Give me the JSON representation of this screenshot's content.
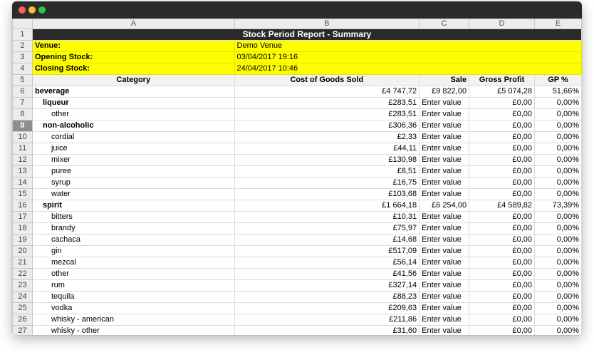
{
  "columns": [
    "A",
    "B",
    "C",
    "D",
    "E"
  ],
  "title": "Stock Period Report - Summary",
  "info": [
    {
      "label": "Venue:",
      "value": "Demo Venue"
    },
    {
      "label": "Opening Stock:",
      "value": "03/04/2017 19:16"
    },
    {
      "label": "Closing Stock:",
      "value": "24/04/2017 10:46"
    }
  ],
  "table_header": {
    "category": "Category",
    "cogs": "Cost of Goods Sold",
    "sale": "Sale",
    "gross_profit": "Gross Profit",
    "gp": "GP %"
  },
  "selected_row": 9,
  "rows": [
    {
      "row": 6,
      "level": 0,
      "category": "beverage",
      "cogs": "£4 747,72",
      "sale": "£9 822,00",
      "profit": "£5 074,28",
      "gp": "51,66%"
    },
    {
      "row": 7,
      "level": 1,
      "category": "liqueur",
      "cogs": "£283,51",
      "sale": "Enter value",
      "profit": "£0,00",
      "gp": "0,00%"
    },
    {
      "row": 8,
      "level": 2,
      "category": "other",
      "cogs": "£283,51",
      "sale": "Enter value",
      "profit": "£0,00",
      "gp": "0,00%"
    },
    {
      "row": 9,
      "level": 1,
      "category": "non-alcoholic",
      "cogs": "£306,36",
      "sale": "Enter value",
      "profit": "£0,00",
      "gp": "0,00%"
    },
    {
      "row": 10,
      "level": 2,
      "category": "cordial",
      "cogs": "£2,33",
      "sale": "Enter value",
      "profit": "£0,00",
      "gp": "0,00%"
    },
    {
      "row": 11,
      "level": 2,
      "category": "juice",
      "cogs": "£44,11",
      "sale": "Enter value",
      "profit": "£0,00",
      "gp": "0,00%"
    },
    {
      "row": 12,
      "level": 2,
      "category": "mixer",
      "cogs": "£130,98",
      "sale": "Enter value",
      "profit": "£0,00",
      "gp": "0,00%"
    },
    {
      "row": 13,
      "level": 2,
      "category": "puree",
      "cogs": "£8,51",
      "sale": "Enter value",
      "profit": "£0,00",
      "gp": "0,00%"
    },
    {
      "row": 14,
      "level": 2,
      "category": "syrup",
      "cogs": "£16,75",
      "sale": "Enter value",
      "profit": "£0,00",
      "gp": "0,00%"
    },
    {
      "row": 15,
      "level": 2,
      "category": "water",
      "cogs": "£103,68",
      "sale": "Enter value",
      "profit": "£0,00",
      "gp": "0,00%"
    },
    {
      "row": 16,
      "level": 1,
      "category": "spirit",
      "cogs": "£1 664,18",
      "sale": "£6 254,00",
      "profit": "£4 589,82",
      "gp": "73,39%"
    },
    {
      "row": 17,
      "level": 2,
      "category": "bitters",
      "cogs": "£10,31",
      "sale": "Enter value",
      "profit": "£0,00",
      "gp": "0,00%"
    },
    {
      "row": 18,
      "level": 2,
      "category": "brandy",
      "cogs": "£75,97",
      "sale": "Enter value",
      "profit": "£0,00",
      "gp": "0,00%"
    },
    {
      "row": 19,
      "level": 2,
      "category": "cachaca",
      "cogs": "£14,68",
      "sale": "Enter value",
      "profit": "£0,00",
      "gp": "0,00%"
    },
    {
      "row": 20,
      "level": 2,
      "category": "gin",
      "cogs": "£517,09",
      "sale": "Enter value",
      "profit": "£0,00",
      "gp": "0,00%"
    },
    {
      "row": 21,
      "level": 2,
      "category": "mezcal",
      "cogs": "£56,14",
      "sale": "Enter value",
      "profit": "£0,00",
      "gp": "0,00%"
    },
    {
      "row": 22,
      "level": 2,
      "category": "other",
      "cogs": "£41,56",
      "sale": "Enter value",
      "profit": "£0,00",
      "gp": "0,00%"
    },
    {
      "row": 23,
      "level": 2,
      "category": "rum",
      "cogs": "£327,14",
      "sale": "Enter value",
      "profit": "£0,00",
      "gp": "0,00%"
    },
    {
      "row": 24,
      "level": 2,
      "category": "tequila",
      "cogs": "£88,23",
      "sale": "Enter value",
      "profit": "£0,00",
      "gp": "0,00%"
    },
    {
      "row": 25,
      "level": 2,
      "category": "vodka",
      "cogs": "£209,63",
      "sale": "Enter value",
      "profit": "£0,00",
      "gp": "0,00%"
    },
    {
      "row": 26,
      "level": 2,
      "category": "whisky - american",
      "cogs": "£211,86",
      "sale": "Enter value",
      "profit": "£0,00",
      "gp": "0,00%"
    },
    {
      "row": 27,
      "level": 2,
      "category": "whisky - other",
      "cogs": "£31,60",
      "sale": "Enter value",
      "profit": "£0,00",
      "gp": "0,00%"
    }
  ],
  "colors": {
    "title_bar": "#2a2a2a",
    "highlight": "#fffe00",
    "window_chrome": "#2b2b2b"
  }
}
